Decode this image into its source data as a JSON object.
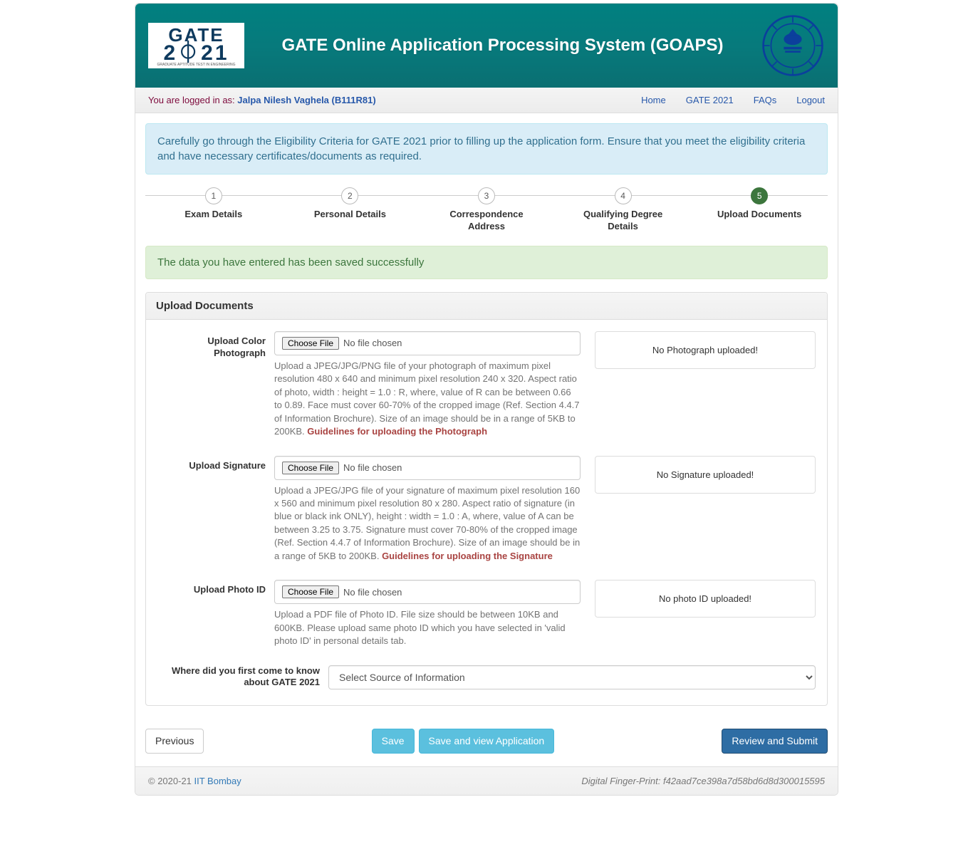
{
  "header": {
    "title": "GATE Online Application Processing System (GOAPS)",
    "logo_line1": "GATE",
    "logo_line2_a": "2",
    "logo_line2_b": "21",
    "logo_tag": "GRADUATE APTITUDE TEST IN ENGINEERING"
  },
  "login_bar": {
    "prefix": "You are logged in as: ",
    "user": "Jalpa Nilesh Vaghela (B111R81)"
  },
  "nav": {
    "home": "Home",
    "gate": "GATE 2021",
    "faqs": "FAQs",
    "logout": "Logout"
  },
  "info_alert": {
    "pre": "Carefully go through the ",
    "link": "Eligibility Criteria for GATE 2021",
    "post": " prior to filling up the application form. Ensure that you meet the eligibility criteria and have necessary certificates/documents as required."
  },
  "steps": [
    {
      "num": "1",
      "label_a": "Exam Details",
      "label_b": ""
    },
    {
      "num": "2",
      "label_a": "Personal Details",
      "label_b": ""
    },
    {
      "num": "3",
      "label_a": "Correspondence",
      "label_b": "Address"
    },
    {
      "num": "4",
      "label_a": "Qualifying Degree",
      "label_b": "Details"
    },
    {
      "num": "5",
      "label_a": "Upload Documents",
      "label_b": ""
    }
  ],
  "success_alert": "The data you have entered has been saved successfully",
  "panel_title": "Upload Documents",
  "uploads": {
    "photo": {
      "label": "Upload Color Photograph",
      "choose": "Choose File",
      "status": "No file chosen",
      "help": "Upload a JPEG/JPG/PNG file of your photograph of maximum pixel resolution 480 x 640 and minimum pixel resolution 240 x 320. Aspect ratio of photo, width : height = 1.0 : R, where, value of R can be between 0.66 to 0.89. Face must cover 60-70% of the cropped image (Ref. Section 4.4.7 of Information Brochure). Size of an image should be in a range of 5KB to 200KB. ",
      "guide": "Guidelines for uploading the Photograph",
      "preview": "No Photograph uploaded!"
    },
    "signature": {
      "label": "Upload Signature",
      "choose": "Choose File",
      "status": "No file chosen",
      "help": "Upload a JPEG/JPG file of your signature of maximum pixel resolution 160 x 560 and minimum pixel resolution 80 x 280. Aspect ratio of signature (in blue or black ink ONLY), height : width = 1.0 : A, where, value of A can be between 3.25 to 3.75. Signature must cover 70-80% of the cropped image (Ref. Section 4.4.7 of Information Brochure). Size of an image should be in a range of 5KB to 200KB. ",
      "guide": "Guidelines for uploading the Signature",
      "preview": "No Signature uploaded!"
    },
    "photoid": {
      "label": "Upload Photo ID",
      "choose": "Choose File",
      "status": "No file chosen",
      "help": "Upload a PDF file of Photo ID. File size should be between 10KB and 600KB. Please upload same photo ID which you have selected in 'valid photo ID' in personal details tab.",
      "preview": "No photo ID uploaded!"
    }
  },
  "source": {
    "label": "Where did you first come to know about GATE 2021",
    "placeholder": "Select Source of Information"
  },
  "buttons": {
    "previous": "Previous",
    "save": "Save",
    "save_view": "Save and view Application",
    "review": "Review and Submit"
  },
  "footer": {
    "copy": "© 2020-21 ",
    "link": "IIT Bombay",
    "fp_label": "Digital Finger-Print: ",
    "fp_val": "f42aad7ce398a7d58bd6d8d300015595"
  }
}
